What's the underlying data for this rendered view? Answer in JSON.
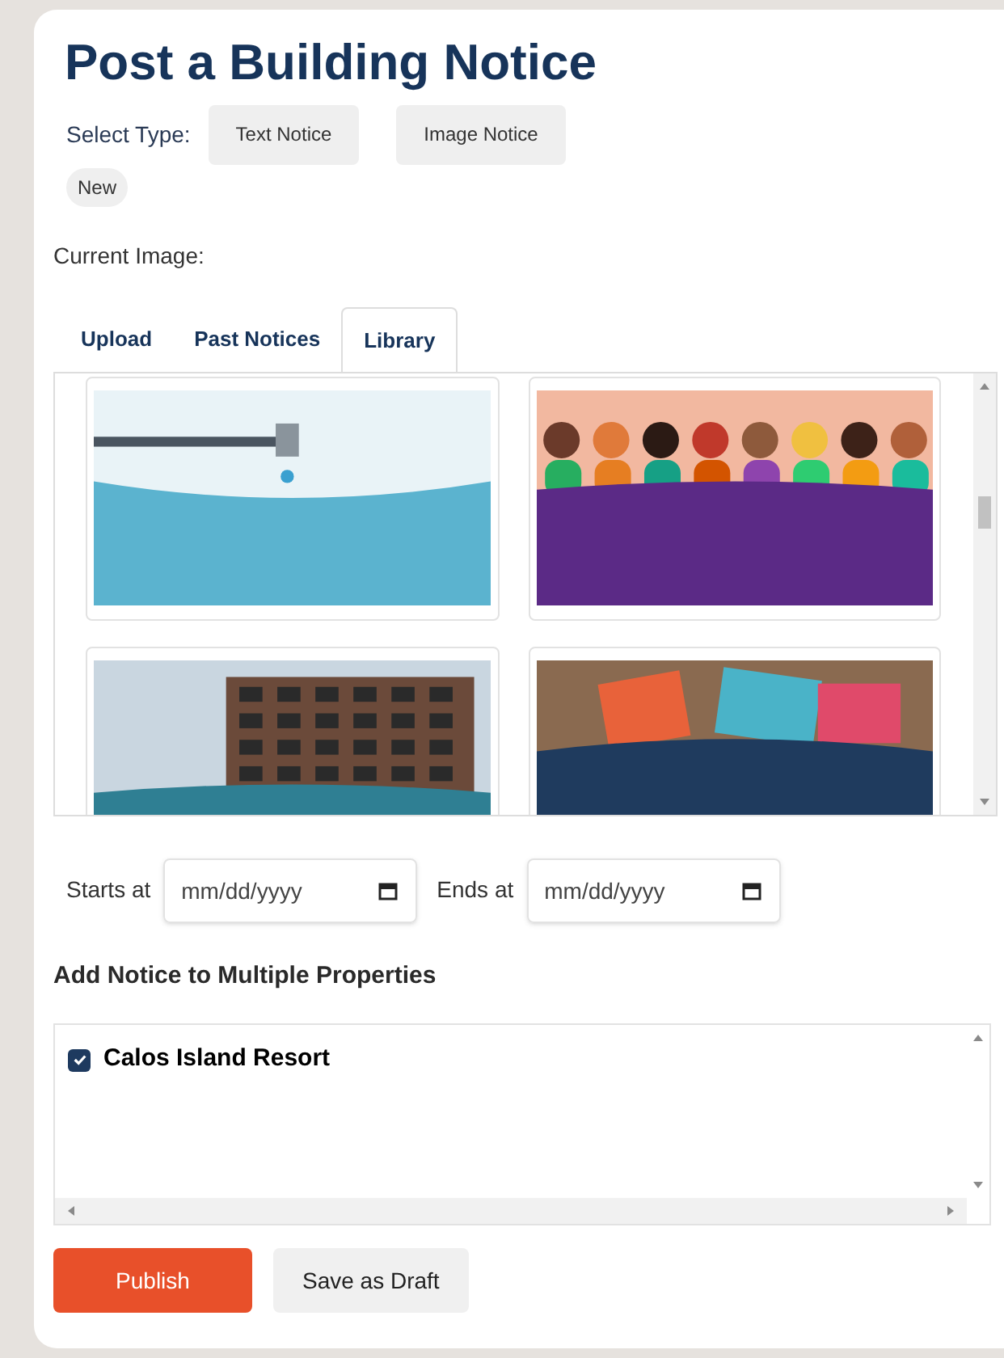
{
  "title": "Post a Building Notice",
  "type_selector": {
    "label": "Select Type:",
    "options": [
      {
        "label": "Text Notice",
        "selected": false
      },
      {
        "label": "Image Notice",
        "selected": false
      }
    ],
    "badge": "New"
  },
  "current_image_label": "Current Image:",
  "tabs": [
    {
      "label": "Upload",
      "selected": false
    },
    {
      "label": "Past Notices",
      "selected": false
    },
    {
      "label": "Library",
      "selected": true
    }
  ],
  "library": [
    {
      "kind": "faucet",
      "selected": false
    },
    {
      "kind": "crowd",
      "selected": false
    },
    {
      "kind": "building",
      "selected": false
    },
    {
      "kind": "papers",
      "selected": false
    }
  ],
  "dates": [
    {
      "label": "Starts at",
      "placeholder": "mm/dd/yyyy"
    },
    {
      "label": "Ends at",
      "placeholder": "mm/dd/yyyy"
    }
  ],
  "properties": {
    "heading": "Add Notice to Multiple Properties",
    "items": [
      {
        "name": "Calos Island Resort",
        "checked": true
      }
    ]
  },
  "buttons": [
    {
      "kind": "primary",
      "label": "Publish"
    },
    {
      "kind": "secondary",
      "label": "Save as Draft"
    }
  ]
}
